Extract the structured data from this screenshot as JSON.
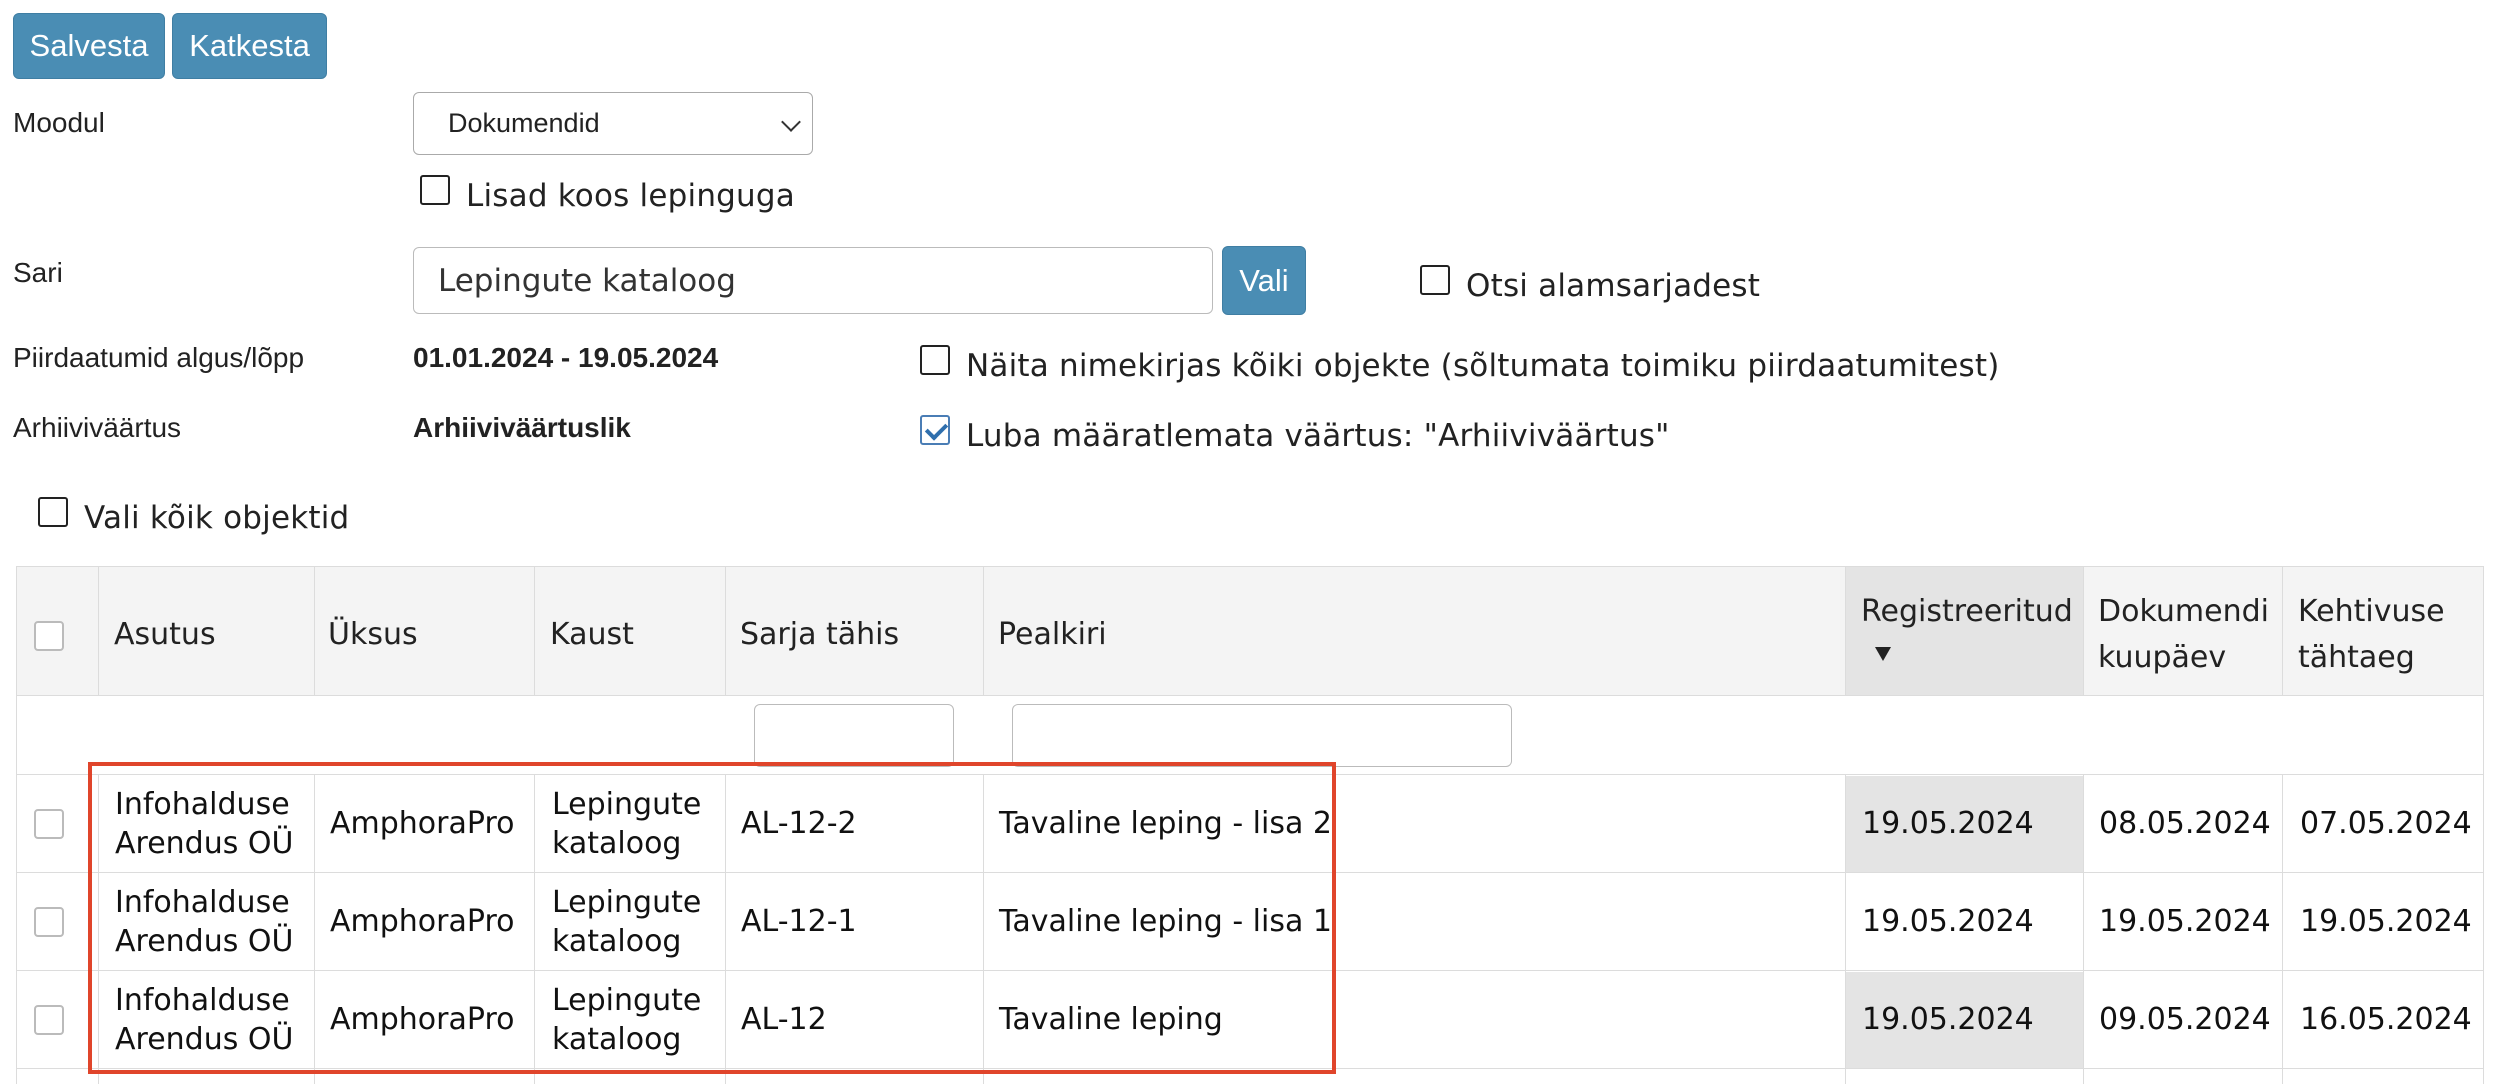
{
  "toolbar": {
    "save_label": "Salvesta",
    "cancel_label": "Katkesta"
  },
  "form": {
    "module_label": "Moodul",
    "module_value": "Dokumendid",
    "attachments_label": "Lisad koos lepinguga",
    "series_label": "Sari",
    "series_value": "Lepingute kataloog",
    "choose_label": "Vali",
    "search_subseries_label": "Otsi alamsarjadest",
    "date_range_label": "Piirdaatumid algus/lõpp",
    "date_range_value": "01.01.2024 - 19.05.2024",
    "show_all_label": "Näita nimekirjas kõiki objekte (sõltumata toimiku piirdaatumitest)",
    "archive_label": "Arhiiviväärtus",
    "archive_value": "Arhiiviväärtuslik",
    "allow_undefined_label": "Luba määratlemata väärtus: \"Arhiiviväärtus\"",
    "select_all_label": "Vali kõik objektid"
  },
  "table": {
    "headers": {
      "org": "Asutus",
      "unit": "Üksus",
      "folder": "Kaust",
      "series_code": "Sarja tähis",
      "title": "Pealkiri",
      "registered_1": "Registreeritud",
      "doc_date_1": "Dokumendi",
      "doc_date_2": "kuupäev",
      "validity_1": "Kehtivuse",
      "validity_2": "tähtaeg"
    },
    "rows": [
      {
        "org1": "Infohalduse",
        "org2": "Arendus OÜ",
        "unit": "AmphoraPro",
        "folder1": "Lepingute",
        "folder2": "kataloog",
        "code": "AL-12-2",
        "title": "Tavaline leping - lisa 2",
        "registered": "19.05.2024",
        "doc_date": "08.05.2024",
        "validity": "07.05.2024"
      },
      {
        "org1": "Infohalduse",
        "org2": "Arendus OÜ",
        "unit": "AmphoraPro",
        "folder1": "Lepingute",
        "folder2": "kataloog",
        "code": "AL-12-1",
        "title": "Tavaline leping - lisa 1",
        "registered": "19.05.2024",
        "doc_date": "19.05.2024",
        "validity": "19.05.2024"
      },
      {
        "org1": "Infohalduse",
        "org2": "Arendus OÜ",
        "unit": "AmphoraPro",
        "folder1": "Lepingute",
        "folder2": "kataloog",
        "code": "AL-12",
        "title": "Tavaline leping",
        "registered": "19.05.2024",
        "doc_date": "09.05.2024",
        "validity": "16.05.2024"
      }
    ]
  },
  "colors": {
    "button": "#4a8db4",
    "highlight": "#e0452b",
    "sorted_column": "#e4e4e4"
  },
  "icons": {
    "sort": "triangle-down-icon",
    "dropdown": "chevron-down-icon"
  }
}
